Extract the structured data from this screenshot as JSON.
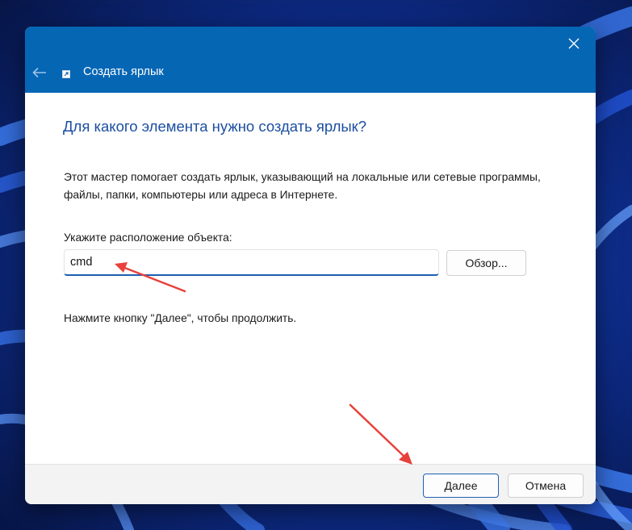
{
  "window": {
    "title": "Создать ярлык",
    "close_icon": "close-icon",
    "back_icon": "back-arrow-icon",
    "title_icon": "shortcut-icon"
  },
  "content": {
    "heading": "Для какого элемента нужно создать ярлык?",
    "description": "Этот мастер помогает создать ярлык, указывающий на локальные или сетевые программы, файлы, папки, компьютеры или адреса в Интернете.",
    "location_label": "Укажите расположение объекта:",
    "location_value": "cmd",
    "browse_label": "Обзор...",
    "hint": "Нажмите кнопку \"Далее\", чтобы продолжить."
  },
  "footer": {
    "next_label": "Далее",
    "cancel_label": "Отмена"
  },
  "colors": {
    "titlebar": "#0566b4",
    "heading": "#1c4fa0",
    "annotation_arrow": "#e8413c",
    "input_accent": "#1c5fb0"
  }
}
